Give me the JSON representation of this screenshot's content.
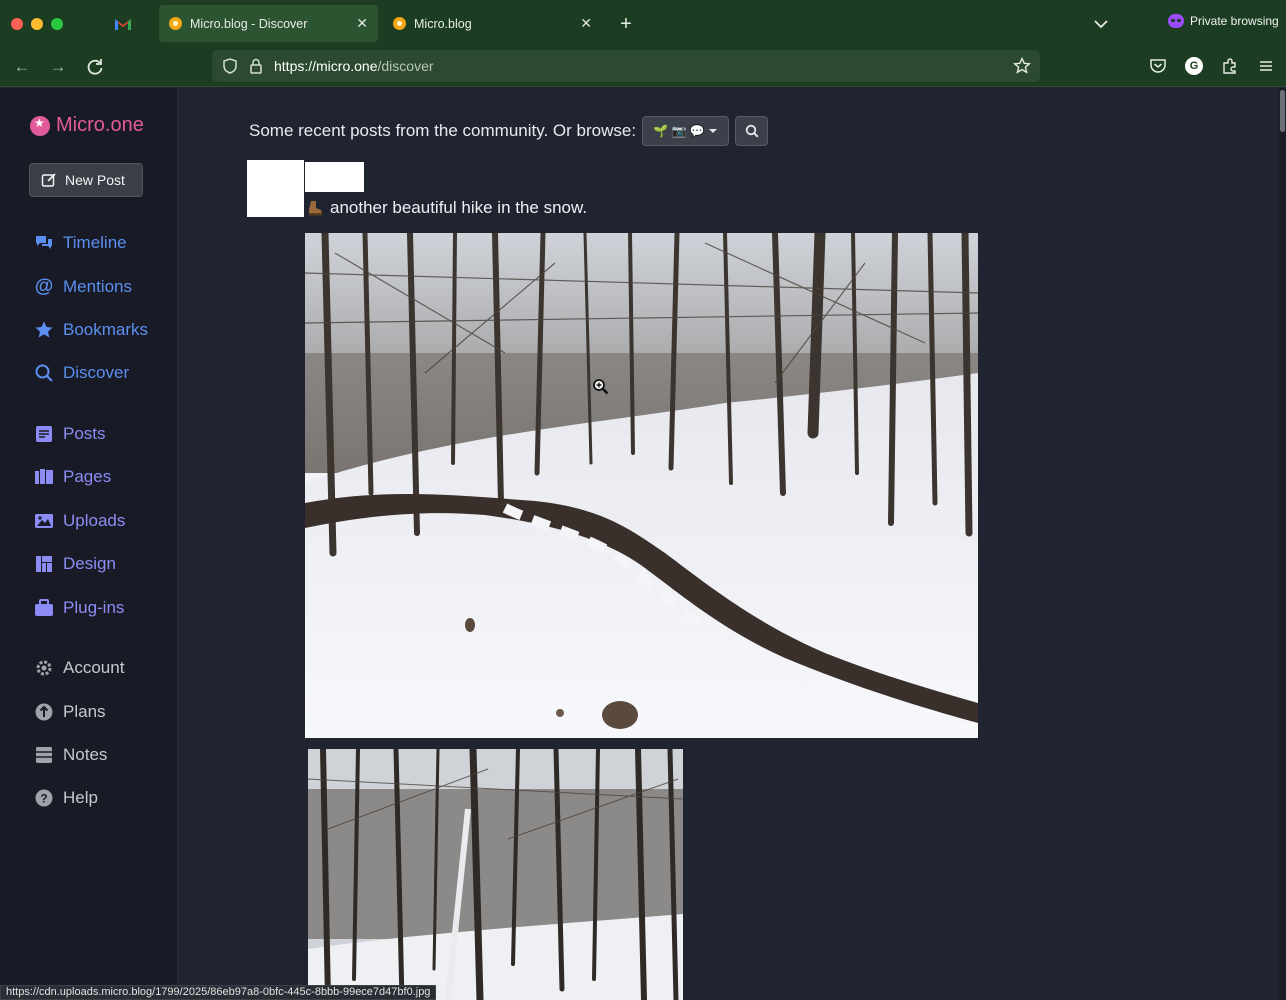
{
  "browser": {
    "tabs": [
      {
        "label": "Micro.blog - Discover",
        "active": true
      },
      {
        "label": "Micro.blog",
        "active": false
      }
    ],
    "pinned_tab_icon": "gmail-icon",
    "private_label": "Private browsing",
    "url_host": "https://micro.one",
    "url_path": "/discover",
    "profile_initial": "G",
    "status_url": "https://cdn.uploads.micro.blog/1799/2025/86eb97a8-0bfc-445c-8bbb-99ece7d47bf0.jpg"
  },
  "sidebar": {
    "brand": "Micro.one",
    "new_post": "New Post",
    "items": [
      {
        "label": "Timeline",
        "icon": "comments-icon"
      },
      {
        "label": "Mentions",
        "icon": "at-icon"
      },
      {
        "label": "Bookmarks",
        "icon": "star-icon"
      },
      {
        "label": "Discover",
        "icon": "search-icon"
      },
      {
        "label": "Posts",
        "icon": "file-text-icon"
      },
      {
        "label": "Pages",
        "icon": "pages-icon"
      },
      {
        "label": "Uploads",
        "icon": "image-icon"
      },
      {
        "label": "Design",
        "icon": "layout-icon"
      },
      {
        "label": "Plug-ins",
        "icon": "briefcase-icon"
      },
      {
        "label": "Account",
        "icon": "gear-icon"
      },
      {
        "label": "Plans",
        "icon": "plans-icon"
      },
      {
        "label": "Notes",
        "icon": "notes-icon"
      },
      {
        "label": "Help",
        "icon": "help-icon"
      }
    ]
  },
  "main": {
    "intro": "Some recent posts from the community. Or browse:",
    "browse_emoji": "🌱 📷 💬",
    "post": {
      "text": "another beautiful hike in the snow.",
      "emoji_icon": "hiking-boot-icon"
    }
  },
  "colors": {
    "chrome_green": "#1c3d21",
    "sidebar_bg": "#181b25",
    "main_bg": "#1f2430",
    "brand_pink": "#e25a9a",
    "nav_blue": "#5b8ef0",
    "nav_violet": "#8d8cf6"
  }
}
